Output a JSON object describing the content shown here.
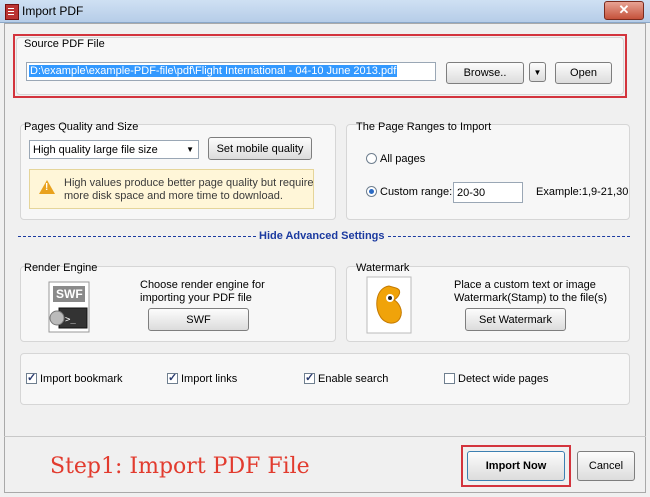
{
  "window": {
    "title": "Import PDF",
    "close_glyph": "✕",
    "icon": "pdf-app-icon"
  },
  "source": {
    "group_label": "Source PDF File",
    "path_value": "D:\\example\\example-PDF-file\\pdf\\Flight International - 04-10 June 2013.pdf",
    "browse_label": "Browse..",
    "dropdown_glyph": "▼",
    "open_label": "Open"
  },
  "quality": {
    "group_label": "Pages Quality and Size",
    "selected": "High quality large file size",
    "mobile_label": "Set mobile quality",
    "warning_line1": "High values produce better page quality but require",
    "warning_line2": "more disk space and more time to download."
  },
  "ranges": {
    "group_label": "The Page Ranges to Import",
    "all_pages_label": "All pages",
    "custom_label": "Custom range:",
    "custom_value": "20-30",
    "example_text": "Example:1,9-21,30",
    "selected": "custom"
  },
  "advanced": {
    "label": "Hide Advanced Settings"
  },
  "render": {
    "group_label": "Render Engine",
    "desc_line1": "Choose render engine for",
    "desc_line2": "importing your PDF file",
    "button_label": "SWF",
    "icon_text": "SWF"
  },
  "watermark": {
    "group_label": "Watermark",
    "desc_line1": "Place a custom text or image",
    "desc_line2": "Watermark(Stamp) to the file(s)",
    "button_label": "Set Watermark"
  },
  "options": [
    {
      "label": "Import bookmark",
      "checked": true
    },
    {
      "label": "Import links",
      "checked": true
    },
    {
      "label": "Enable search",
      "checked": true
    },
    {
      "label": "Detect wide pages",
      "checked": false
    }
  ],
  "footer": {
    "step_text": "Step1: Import PDF File",
    "import_label": "Import Now",
    "cancel_label": "Cancel"
  },
  "colors": {
    "highlight_red": "#d3343d",
    "link_blue": "#1b3aa0",
    "warning_bg": "#fff6d8"
  }
}
